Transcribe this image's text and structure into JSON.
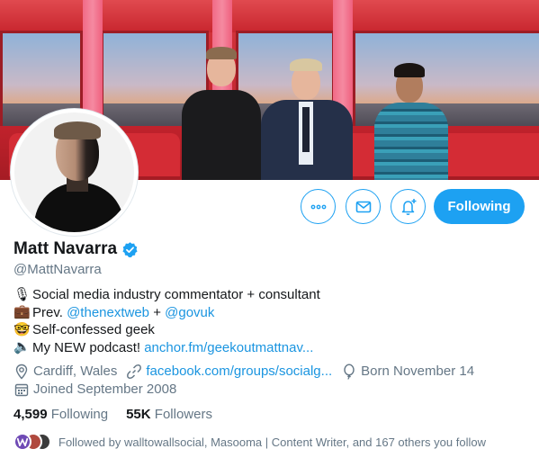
{
  "profile": {
    "name": "Matt Navarra",
    "handle": "@MattNavarra",
    "verified": true
  },
  "actions": {
    "more_icon": "more-icon",
    "message_icon": "mail-icon",
    "notify_icon": "bell-add-icon",
    "follow_label": "Following"
  },
  "bio": [
    {
      "icon": "microphone-emoji",
      "glyph": "🎙",
      "text": "Social media industry commentator + consultant"
    },
    {
      "icon": "briefcase-emoji",
      "glyph": "💼",
      "prefix": "Prev. ",
      "link1": "@thenextweb",
      "mid": " + ",
      "link2": "@govuk"
    },
    {
      "icon": "nerd-face-emoji",
      "glyph": "🤓",
      "text": "Self-confessed geek"
    },
    {
      "icon": "speaker-emoji",
      "glyph": "🔈",
      "prefix": "My NEW podcast! ",
      "link1": "anchor.fm/geekoutmattnav..."
    }
  ],
  "meta": {
    "location": "Cardiff, Wales",
    "website": "facebook.com/groups/socialg...",
    "birthday": "Born November 14",
    "joined": "Joined September 2008"
  },
  "stats": {
    "following_count": "4,599",
    "following_label": "Following",
    "followers_count": "55K",
    "followers_label": "Followers"
  },
  "followed_by": {
    "text": "Followed by walltowallsocial, Masooma | Content Writer, and 167 others you follow"
  },
  "colors": {
    "accent": "#1da1f2",
    "link": "#1b95e0",
    "secondary_text": "#657786",
    "primary_text": "#14171a"
  }
}
